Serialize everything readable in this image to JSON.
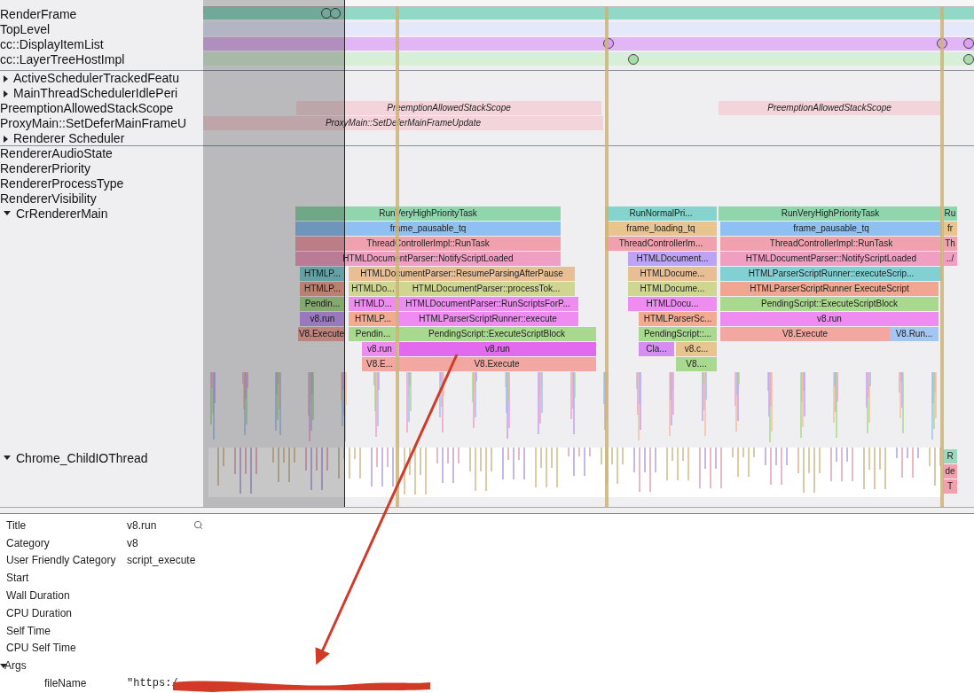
{
  "tracks": [
    {
      "label": "RenderFrame",
      "kind": "plain"
    },
    {
      "label": "TopLevel",
      "kind": "plain"
    },
    {
      "label": "cc::DisplayItemList",
      "kind": "plain"
    },
    {
      "label": "cc::LayerTreeHostImpl",
      "kind": "plain"
    },
    {
      "label": "ActiveSchedulerTrackedFeatu",
      "kind": "group",
      "expanded": false
    },
    {
      "label": "MainThreadSchedulerIdlePeri",
      "kind": "group",
      "expanded": false
    },
    {
      "label": "PreemptionAllowedStackScope",
      "kind": "plain",
      "slices": [
        "PreemptionAllowedStackScope",
        "PreemptionAllowedStackScope"
      ]
    },
    {
      "label": "ProxyMain::SetDeferMainFrameU",
      "kind": "plain",
      "slices": [
        "ProxyMain::SetDeferMainFrameUpdate"
      ]
    },
    {
      "label": "Renderer Scheduler",
      "kind": "group",
      "expanded": false
    },
    {
      "label": "RendererAudioState",
      "kind": "plain"
    },
    {
      "label": "RendererPriority",
      "kind": "plain"
    },
    {
      "label": "RendererProcessType",
      "kind": "plain"
    },
    {
      "label": "RendererVisibility",
      "kind": "plain"
    },
    {
      "label": "CrRendererMain",
      "kind": "group",
      "expanded": true,
      "flame": [
        [
          "RunVeryHighPriorityTask",
          "RunNormalPri...",
          "RunVeryHighPriorityTask",
          "Ru"
        ],
        [
          "frame_pausable_tq",
          "frame_loading_tq",
          "frame_pausable_tq",
          "fr"
        ],
        [
          "ThreadControllerImpl::RunTask",
          "ThreadControllerIm...",
          "ThreadControllerImpl::RunTask",
          "Th"
        ],
        [
          "HTMLDocumentParser::NotifyScriptLoaded",
          "HTMLDocument...",
          "HTMLDocumentParser::NotifyScriptLoaded",
          "../"
        ],
        [
          "HTMLP...",
          "HTMLDocumentParser::ResumeParsingAfterPause",
          "HTMLDocume...",
          "HTMLParserScriptRunner::executeScrip..."
        ],
        [
          "HTMLP...",
          "HTMLDo...",
          "HTMLDocumentParser::processTok...",
          "HTMLDocume...",
          "HTMLParserScriptRunner ExecuteScript"
        ],
        [
          "Pendin...",
          "HTMLD...",
          "HTMLDocumentParser::RunScriptsForP...",
          "HTMLDocu...",
          "PendingScript::ExecuteScriptBlock"
        ],
        [
          "v8.run",
          "HTMLP...",
          "HTMLParserScriptRunner::execute",
          "HTMLParserSc...",
          "v8.run"
        ],
        [
          "V8.Execute",
          "Pendin...",
          "PendingScript::ExecuteScriptBlock",
          "PendingScript::...",
          "V8.Execute",
          "V8.Run..."
        ],
        [
          "v8.run",
          "v8.run",
          "Cla...",
          "v8.c..."
        ],
        [
          "V8.E...",
          "V8.Execute",
          "V8...."
        ]
      ]
    },
    {
      "label": "Chrome_ChildIOThread",
      "kind": "group",
      "expanded": true,
      "slices": [
        "R",
        "de",
        "T"
      ]
    }
  ],
  "details": {
    "rows": [
      {
        "label": "Title",
        "value": "v8.run",
        "kind": "title"
      },
      {
        "label": "Category",
        "value": "v8",
        "kind": "field"
      },
      {
        "label": "User Friendly Category",
        "value": "script_execute",
        "kind": "field"
      },
      {
        "label": "Start",
        "kind": "field"
      },
      {
        "label": "Wall Duration",
        "kind": "field"
      },
      {
        "label": "CPU Duration",
        "kind": "field"
      },
      {
        "label": "Self Time",
        "kind": "field"
      },
      {
        "label": "CPU Self Time",
        "kind": "field"
      }
    ],
    "args": {
      "label": "Args",
      "expanded": true,
      "rows": [
        {
          "label": "fileName",
          "value": "\"https:/"
        }
      ]
    }
  }
}
